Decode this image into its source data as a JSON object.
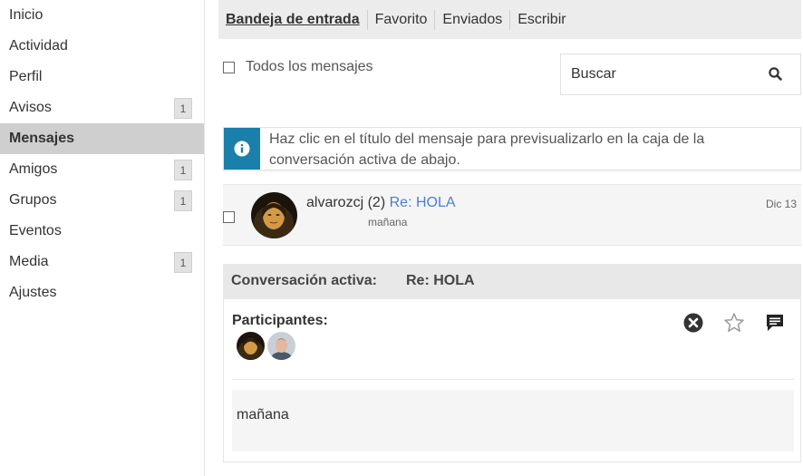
{
  "sidebar": {
    "items": [
      {
        "label": "Inicio",
        "badge": ""
      },
      {
        "label": "Actividad",
        "badge": ""
      },
      {
        "label": "Perfil",
        "badge": ""
      },
      {
        "label": "Avisos",
        "badge": "1"
      },
      {
        "label": "Mensajes",
        "badge": "",
        "active": true
      },
      {
        "label": "Amigos",
        "badge": "1"
      },
      {
        "label": "Grupos",
        "badge": "1"
      },
      {
        "label": "Eventos",
        "badge": ""
      },
      {
        "label": "Media",
        "badge": "1"
      },
      {
        "label": "Ajustes",
        "badge": ""
      }
    ]
  },
  "tabs": [
    {
      "label": "Bandeja de entrada",
      "active": true
    },
    {
      "label": "Favorito"
    },
    {
      "label": "Enviados"
    },
    {
      "label": "Escribir"
    }
  ],
  "select_all": {
    "label": "Todos los mensajes"
  },
  "search": {
    "placeholder": "Buscar",
    "icon": "search-icon"
  },
  "info": {
    "text": "Haz clic en el título del mensaje para previsualizarlo en la caja de la conversación activa de abajo.",
    "icon": "info-icon",
    "color": "#1a7fab"
  },
  "messages": [
    {
      "sender": "alvarozcj",
      "count": "(2)",
      "subject": "Re: HOLA",
      "excerpt": "mañana",
      "date": "Dic 13"
    }
  ],
  "conversation": {
    "label": "Conversación activa:",
    "subject": "Re: HOLA",
    "participants_label": "Participantes:",
    "actions": [
      "delete-icon",
      "star-icon",
      "reply-icon"
    ],
    "body": "mañana"
  },
  "colors": {
    "accent": "#1a7fab",
    "link": "#4a7fcc",
    "active_nav": "#cfcfcf"
  }
}
